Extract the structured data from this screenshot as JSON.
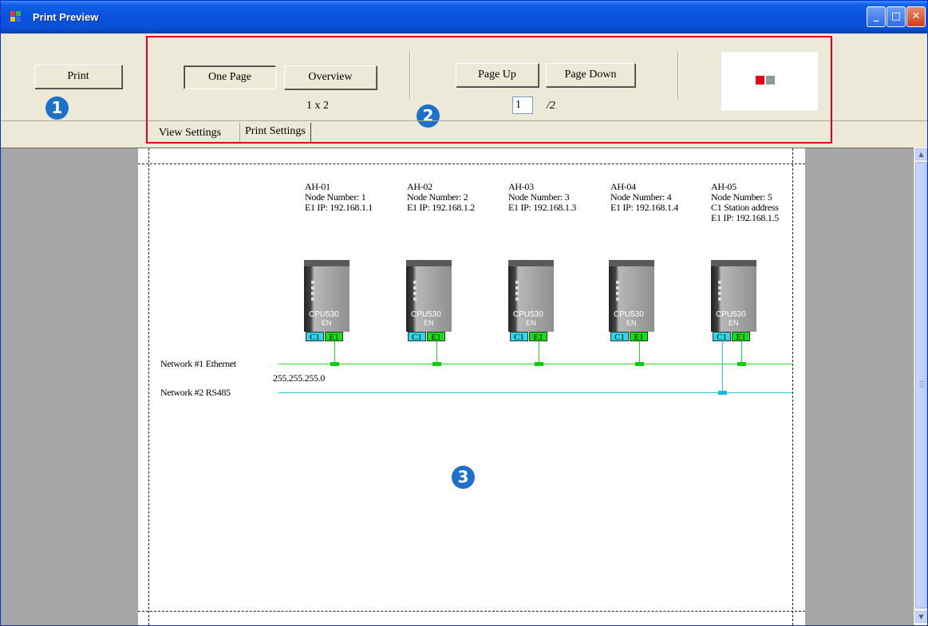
{
  "window": {
    "title": "Print Preview",
    "controls": {
      "minimize": "_",
      "maximize": "□",
      "close": "✕"
    }
  },
  "toolbar": {
    "print_label": "Print",
    "one_page_label": "One Page",
    "overview_label": "Overview",
    "layout_text": "1 x 2",
    "page_up_label": "Page Up",
    "page_down_label": "Page Down",
    "page_number": "1",
    "page_total": "/2"
  },
  "tabs": [
    {
      "label": "View Settings",
      "active": true
    },
    {
      "label": "Print Settings",
      "active": false
    }
  ],
  "callouts": [
    "1",
    "2",
    "3"
  ],
  "diagram": {
    "nodes": [
      {
        "name": "AH-01",
        "node_number": "Node Number: 1",
        "ip": "E1 IP: 192.168.1.1",
        "model": "CPU530",
        "en": "EN",
        "port_c1": "C1",
        "port_e1": "E1"
      },
      {
        "name": "AH-02",
        "node_number": "Node Number: 2",
        "ip": "E1 IP: 192.168.1.2",
        "model": "CPU530",
        "en": "EN",
        "port_c1": "C1",
        "port_e1": "E1"
      },
      {
        "name": "AH-03",
        "node_number": "Node Number: 3",
        "ip": "E1 IP: 192.168.1.3",
        "model": "CPU530",
        "en": "EN",
        "port_c1": "C1",
        "port_e1": "E1"
      },
      {
        "name": "AH-04",
        "node_number": "Node Number: 4",
        "ip": "E1 IP: 192.168.1.4",
        "model": "CPU530",
        "en": "EN",
        "port_c1": "C1",
        "port_e1": "E1"
      },
      {
        "name": "AH-05",
        "node_number": "Node Number: 5",
        "station": "C1 Station address",
        "ip": "E1 IP: 192.168.1.5",
        "model": "CPU530",
        "en": "EN",
        "port_c1": "C1",
        "port_e1": "E1"
      }
    ],
    "networks": [
      {
        "label": "Network #1  Ethernet",
        "subnet": "255.255.255.0",
        "color": "#22dd22"
      },
      {
        "label": "Network #2  RS485",
        "color": "#22c8dd"
      }
    ]
  },
  "colors": {
    "highlight_border": "#e3001b",
    "callout": "#1d72c8",
    "ethernet": "#22dd22",
    "rs485": "#22c8dd"
  }
}
